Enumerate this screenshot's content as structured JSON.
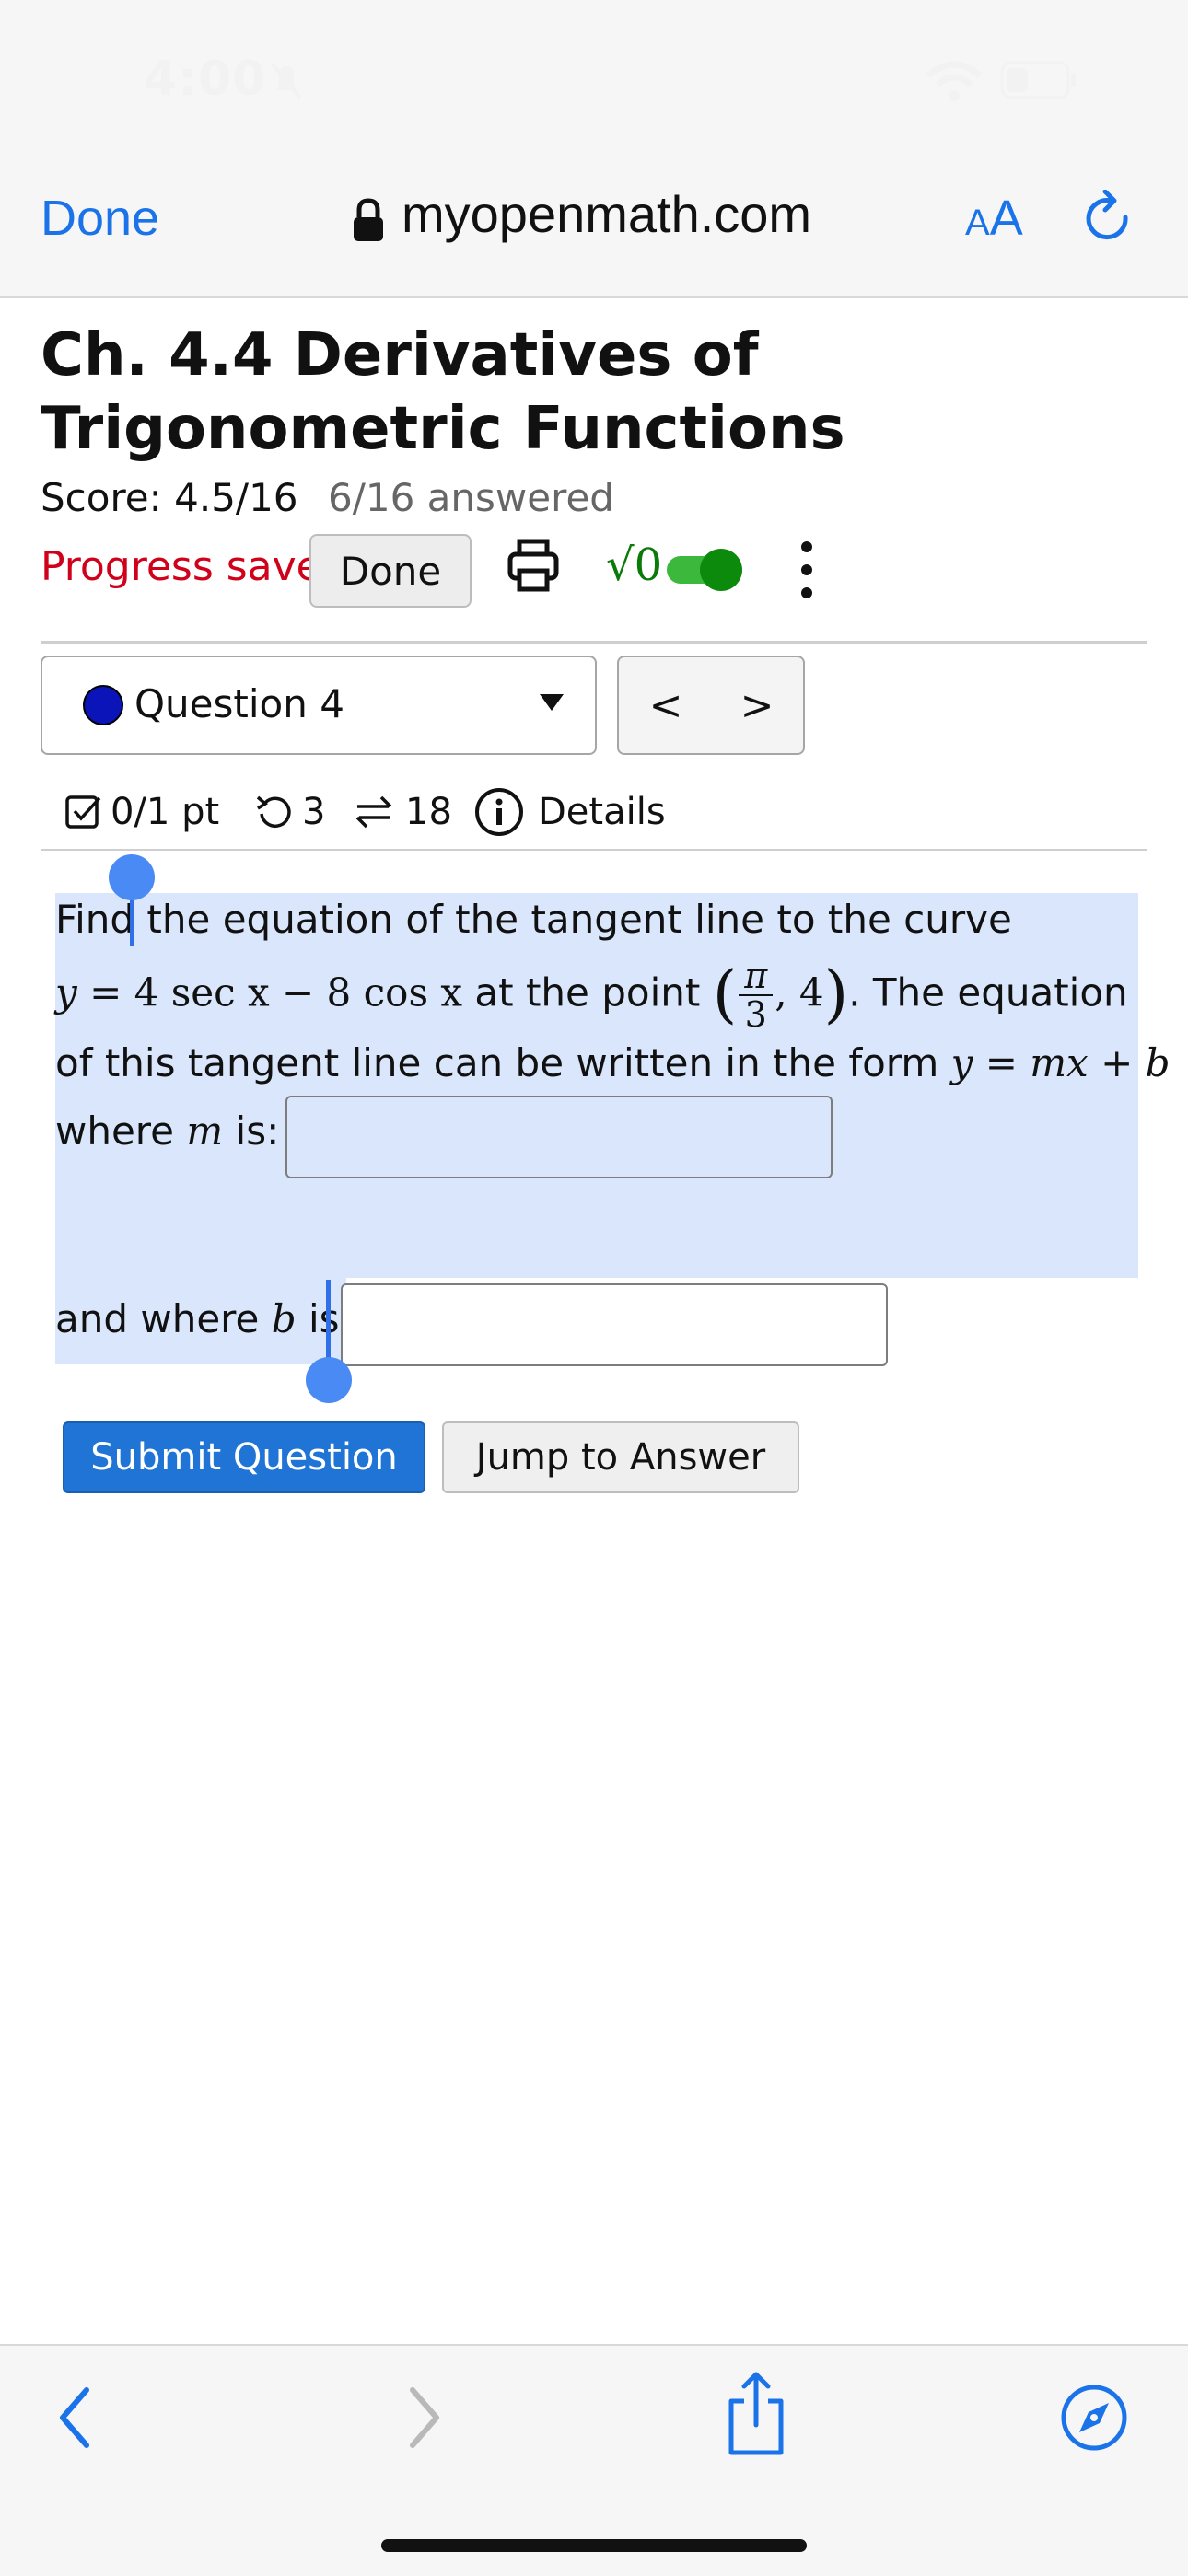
{
  "status_bar": {
    "time": "4:00"
  },
  "browser": {
    "done_label": "Done",
    "url": "myopenmath.com",
    "text_size_label_small": "A",
    "text_size_label_large": "A"
  },
  "page": {
    "title": "Ch. 4.4 Derivatives of Trigonometric Functions",
    "score": "Score: 4.5/16",
    "answered": "6/16 answered",
    "progress": "Progress saved",
    "done_button": "Done",
    "sqrt_label": "√0",
    "question_select": {
      "selected": "Question 4"
    },
    "prev_label": "<",
    "next_label": ">",
    "details": {
      "points": "0/1 pt",
      "retries": "3",
      "versions": "18",
      "details_label": "Details"
    },
    "question": {
      "line1_a": "Find",
      "line1_b": " the equation of the tangent line to the curve",
      "eq_y": "y",
      "eq_rhs": " = 4 sec x − 8 cos x",
      "at_point": " at the point ",
      "frac_num": "π",
      "frac_den": "3",
      "point_rest": ", 4",
      "the_equation": ". The equation",
      "line3": "of this tangent line can be written in the form ",
      "form": "y = mx + b",
      "where_m_pre": "where ",
      "m_var": "m",
      "where_m_post": " is:",
      "where_b_pre": "and where ",
      "b_var": "b",
      "where_b_post": " is:"
    },
    "submit_button": "Submit Question",
    "jump_button": "Jump to Answer"
  }
}
